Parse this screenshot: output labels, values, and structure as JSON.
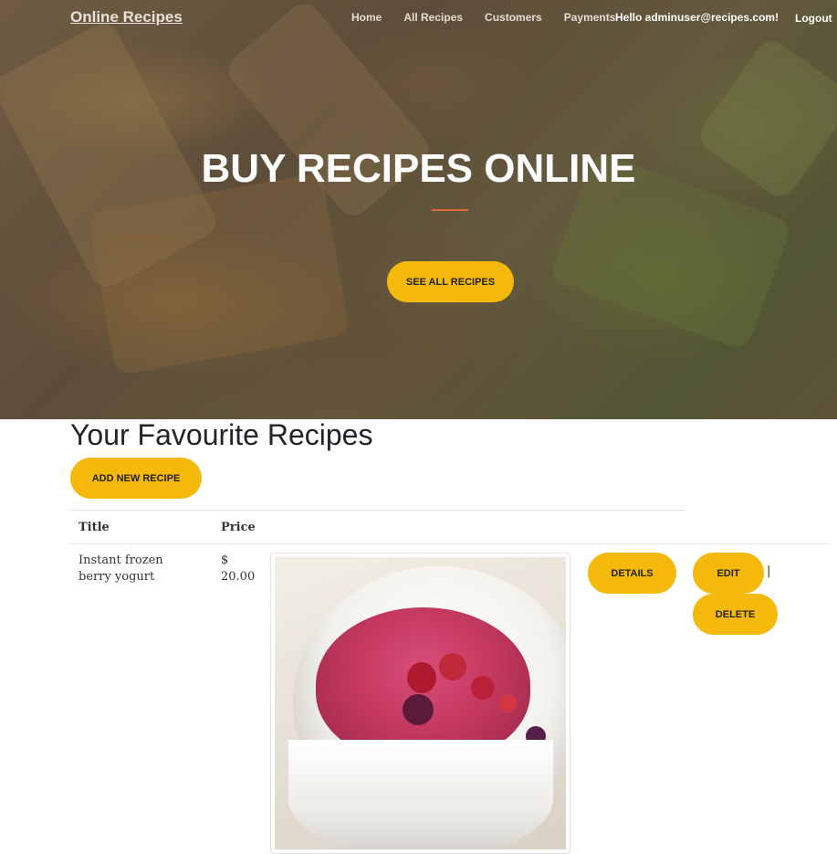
{
  "nav": {
    "brand": "Online Recipes",
    "links": [
      "Home",
      "All Recipes",
      "Customers",
      "Payments"
    ],
    "greeting": "Hello adminuser@recipes.com!",
    "logout": "Logout"
  },
  "hero": {
    "title": "BUY RECIPES ONLINE",
    "cta": "SEE ALL RECIPES"
  },
  "main": {
    "heading": "Your Favourite Recipes",
    "add_button": "ADD NEW RECIPE",
    "table": {
      "columns": [
        "Title",
        "Price"
      ],
      "rows": [
        {
          "title": "Instant frozen berry yogurt",
          "price": "$ 20.00",
          "details": "DETAILS",
          "edit": "EDIT",
          "separator": "|",
          "delete": "DELETE"
        }
      ]
    }
  },
  "colors": {
    "accent": "#f5b90c",
    "divider": "#e3673a"
  }
}
